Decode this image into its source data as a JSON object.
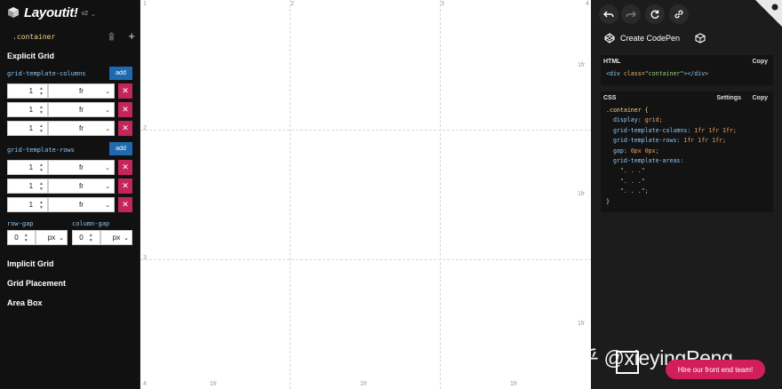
{
  "app": {
    "name": "Layoutit!",
    "version": "v2",
    "container_label": ".container"
  },
  "sidebar": {
    "explicit_grid_title": "Explicit Grid",
    "columns_label": "grid-template-columns",
    "rows_label": "grid-template-rows",
    "add_label": "add",
    "remove_label": "✕",
    "columns": [
      {
        "value": "1",
        "unit": "fr"
      },
      {
        "value": "1",
        "unit": "fr"
      },
      {
        "value": "1",
        "unit": "fr"
      }
    ],
    "rows": [
      {
        "value": "1",
        "unit": "fr"
      },
      {
        "value": "1",
        "unit": "fr"
      },
      {
        "value": "1",
        "unit": "fr"
      }
    ],
    "row_gap_label": "row-gap",
    "column_gap_label": "column-gap",
    "row_gap": {
      "value": "0",
      "unit": "px"
    },
    "column_gap": {
      "value": "0",
      "unit": "px"
    },
    "sections": [
      "Implicit Grid",
      "Grid Placement",
      "Area Box"
    ]
  },
  "canvas": {
    "column_numbers": [
      "1",
      "2",
      "3",
      "4"
    ],
    "row_numbers": [
      "2",
      "3",
      "4"
    ],
    "column_units": [
      "1fr",
      "1fr",
      "1fr"
    ],
    "row_units": [
      "1fr",
      "1fr",
      "1fr"
    ]
  },
  "right_panel": {
    "create_codepen_label": "Create CodePen",
    "html_title": "HTML",
    "css_title": "CSS",
    "copy_label": "Copy",
    "settings_label": "Settings",
    "html_code": {
      "open": "<div",
      "attr": " class=",
      "value": "\"container\"",
      "close": "></div>"
    },
    "css_code": {
      "selector": ".container {",
      "lines": [
        {
          "prop": "display:",
          "val": " grid;"
        },
        {
          "prop": "grid-template-columns:",
          "val": " 1fr 1fr 1fr;"
        },
        {
          "prop": "grid-template-rows:",
          "val": " 1fr 1fr 1fr;"
        },
        {
          "prop": "gap:",
          "val": " 0px 0px;"
        },
        {
          "prop": "grid-template-areas:",
          "val": ""
        }
      ],
      "areas": [
        "\". . .\"",
        "\". . .\"",
        "\". . .\";"
      ],
      "close": "}"
    }
  },
  "watermark": "知乎 @xieyingPeng",
  "hire_button_label": "Hire our front end team!",
  "colors": {
    "add_button": "#1f69b0",
    "remove_button": "#c5265a",
    "hire_button": "#d21f5c",
    "selector": "#f4d386",
    "property": "#8ec7f2"
  }
}
